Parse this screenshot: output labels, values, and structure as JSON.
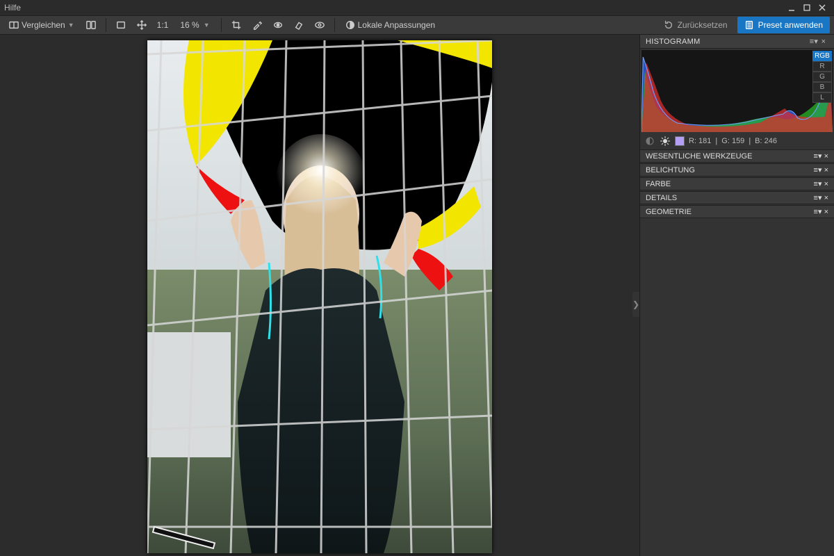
{
  "titlebar": {
    "menu": "Hilfe"
  },
  "toolbar": {
    "compare_label": "Vergleichen",
    "ratio_label": "1:1",
    "zoom_label": "16 %",
    "local_adjust_label": "Lokale Anpassungen",
    "reset_label": "Zurücksetzen",
    "apply_preset_label": "Preset anwenden"
  },
  "rightpanel": {
    "histogram_title": "HISTOGRAMM",
    "channels": [
      "RGB",
      "R",
      "G",
      "B",
      "L"
    ],
    "active_channel": "RGB",
    "readout_r": "R: 181",
    "readout_g": "G: 159",
    "readout_b": "B: 246",
    "sections": [
      "WESENTLICHE WERKZEUGE",
      "BELICHTUNG",
      "FARBE",
      "DETAILS",
      "GEOMETRIE"
    ]
  }
}
